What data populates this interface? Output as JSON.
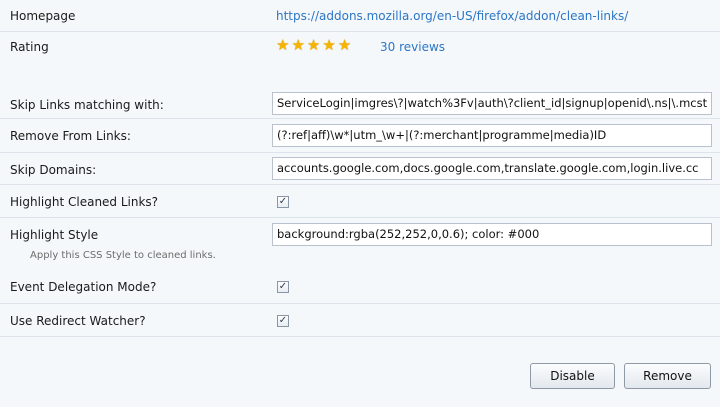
{
  "homepage": {
    "label": "Homepage",
    "url": "https://addons.mozilla.org/en-US/firefox/addon/clean-links/"
  },
  "rating": {
    "label": "Rating",
    "stars_filled": 5,
    "stars_total": 5,
    "reviews_text": "30 reviews"
  },
  "prefs": {
    "skip_links": {
      "label": "Skip Links matching with:",
      "value": "ServiceLogin|imgres\\?|watch%3Fv|auth\\?client_id|signup|openid\\.ns|\\.mcst"
    },
    "remove_from_links": {
      "label": "Remove From Links:",
      "value": "(?:ref|aff)\\w*|utm_\\w+|(?:merchant|programme|media)ID"
    },
    "skip_domains": {
      "label": "Skip Domains:",
      "value": "accounts.google.com,docs.google.com,translate.google.com,login.live.cc"
    },
    "highlight_cleaned": {
      "label": "Highlight Cleaned Links?",
      "checked": true
    },
    "highlight_style": {
      "label": "Highlight Style",
      "description": "Apply this CSS Style to cleaned links.",
      "value": "background:rgba(252,252,0,0.6); color: #000"
    },
    "event_delegation": {
      "label": "Event Delegation Mode?",
      "checked": true
    },
    "redirect_watcher": {
      "label": "Use Redirect Watcher?",
      "checked": true
    }
  },
  "buttons": {
    "disable": "Disable",
    "remove": "Remove"
  },
  "colors": {
    "link": "#2b76c6",
    "star": "#f5b400",
    "background": "#f5f8fb"
  },
  "icons": {
    "star": "star-icon",
    "check": "checkmark-icon"
  }
}
